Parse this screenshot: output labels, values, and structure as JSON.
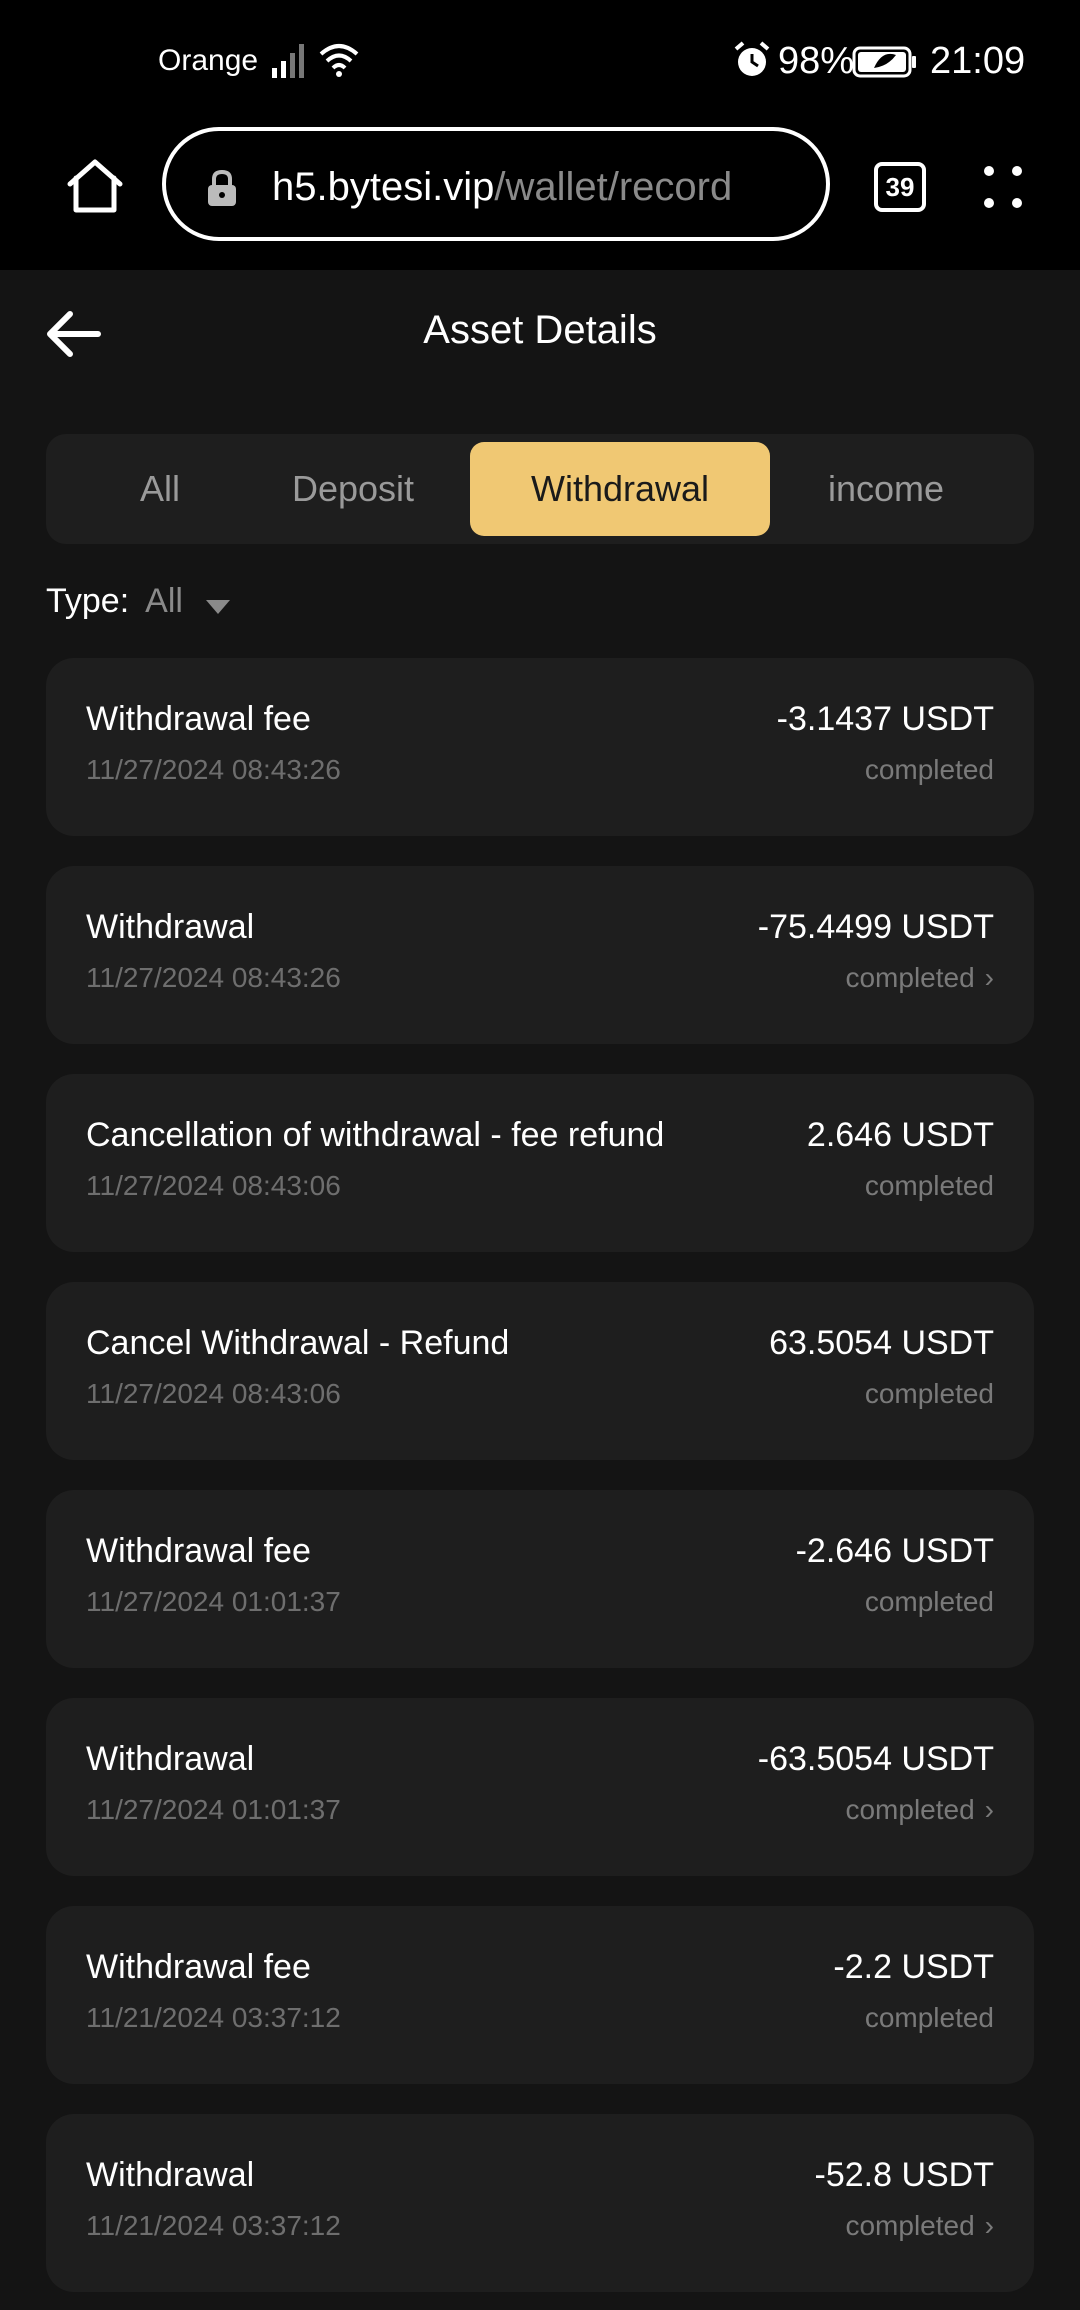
{
  "status_bar": {
    "carrier": "Orange",
    "battery_pct": "98%",
    "time": "21:09"
  },
  "browser": {
    "url_host": "h5.bytesi.vip",
    "url_path": "/wallet/record",
    "tab_count": "39"
  },
  "header": {
    "title": "Asset Details"
  },
  "tabs": [
    {
      "label": "All",
      "active": false
    },
    {
      "label": "Deposit",
      "active": false
    },
    {
      "label": "Withdrawal",
      "active": true
    },
    {
      "label": "income",
      "active": false
    }
  ],
  "filter": {
    "label": "Type:",
    "value": "All"
  },
  "records": [
    {
      "title": "Withdrawal fee",
      "date": "11/27/2024 08:43:26",
      "amount": "-3.1437 USDT",
      "status": "completed",
      "has_detail": false
    },
    {
      "title": "Withdrawal",
      "date": "11/27/2024 08:43:26",
      "amount": "-75.4499 USDT",
      "status": "completed",
      "has_detail": true
    },
    {
      "title": "Cancellation of withdrawal - fee refund",
      "date": "11/27/2024 08:43:06",
      "amount": "2.646 USDT",
      "status": "completed",
      "has_detail": false
    },
    {
      "title": "Cancel Withdrawal - Refund",
      "date": "11/27/2024 08:43:06",
      "amount": "63.5054 USDT",
      "status": "completed",
      "has_detail": false
    },
    {
      "title": "Withdrawal fee",
      "date": "11/27/2024 01:01:37",
      "amount": "-2.646 USDT",
      "status": "completed",
      "has_detail": false
    },
    {
      "title": "Withdrawal",
      "date": "11/27/2024 01:01:37",
      "amount": "-63.5054 USDT",
      "status": "completed",
      "has_detail": true
    },
    {
      "title": "Withdrawal fee",
      "date": "11/21/2024 03:37:12",
      "amount": "-2.2 USDT",
      "status": "completed",
      "has_detail": false
    },
    {
      "title": "Withdrawal",
      "date": "11/21/2024 03:37:12",
      "amount": "-52.8 USDT",
      "status": "completed",
      "has_detail": true
    }
  ],
  "colors": {
    "accent": "#f0c873",
    "background": "#141414",
    "card": "#1e1e1e"
  }
}
